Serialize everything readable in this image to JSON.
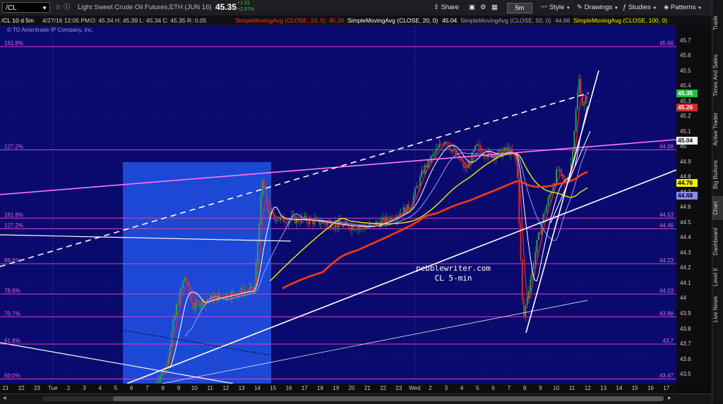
{
  "toolbar": {
    "symbol": "/CL",
    "description": "Light Sweet Crude Oil Futures,ETH (JUN 16)",
    "last_price": "45.35",
    "net_change": "+1.31",
    "pct_change": "+2.97%",
    "share_label": "Share",
    "timeframe": "5m",
    "style_label": "Style",
    "drawings_label": "Drawings",
    "studies_label": "Studies",
    "patterns_label": "Patterns"
  },
  "info": {
    "chart_title": "/CL 10 d 5m",
    "datetime": "4/27/16 12:05 PM",
    "ohlc": "O: 45.34   H: 45.39   L: 45.34   C: 45.35   R: 0.05",
    "sma10_label": "SimpleMovingAvg (CLOSE, 10, 0)",
    "sma10_value": "45.26",
    "sma20_label": "SimpleMovingAvg (CLOSE, 20, 0)",
    "sma20_value": "45.04",
    "sma50_label": "SimpleMovingAvg (CLOSE, 50, 0)",
    "sma50_value": "44.68",
    "sma100_label": "SimpleMovingAvg (CLOSE, 100, 0)",
    "copyright": "© TD Ameritrade IP Company, Inc."
  },
  "annotation": {
    "line1": "pebblewriter.com",
    "line2": "CL 5-min"
  },
  "sidebar": {
    "items": [
      "Trade",
      "Times And Sales",
      "Active Trader",
      "Big Buttons",
      "Chart",
      "Dashboard",
      "Level II",
      "Live News"
    ]
  },
  "colors": {
    "background": "#0a0a6e",
    "candle_up": "#2ea84a",
    "candle_down": "#d0342c",
    "sma10": "#ff2020",
    "sma20": "#ffffff",
    "sma50": "#9a9aff",
    "sma100": "#f0f000",
    "sma_long": "#ff3a10",
    "fib_line": "#cc44cc",
    "pink_trend": "#ff77ff",
    "highlight_box": "#1f4fe0"
  },
  "chart_data": {
    "type": "candlestick",
    "ylim": [
      43.44,
      45.8
    ],
    "yticks": [
      "45.7",
      "45.6",
      "45.5",
      "45.4",
      "45.3",
      "45.2",
      "45.1",
      "45",
      "44.9",
      "44.8",
      "44.7",
      "44.6",
      "44.5",
      "44.4",
      "44.3",
      "44.2",
      "44.1",
      "44",
      "43.9",
      "43.8",
      "43.7",
      "43.6",
      "43.5"
    ],
    "xticks": [
      "21",
      "22",
      "23",
      "Tue",
      "2",
      "3",
      "4",
      "5",
      "6",
      "7",
      "8",
      "9",
      "10",
      "11",
      "12",
      "13",
      "14",
      "15",
      "16",
      "17",
      "18",
      "19",
      "20",
      "21",
      "22",
      "23",
      "Wed",
      "2",
      "3",
      "4",
      "5",
      "6",
      "7",
      "8",
      "9",
      "10",
      "11",
      "12",
      "13",
      "14",
      "15",
      "16",
      "17"
    ],
    "fib_levels": [
      {
        "pct": "161.8%",
        "price": "45.66",
        "value": 45.66
      },
      {
        "pct": "127.2%",
        "price": "44.98",
        "value": 44.98
      },
      {
        "pct": "161.8%",
        "price": "44.53",
        "value": 44.53
      },
      {
        "pct": "127.2%",
        "price": "44.46",
        "value": 44.46
      },
      {
        "pct": "88.6%",
        "price": "44.23",
        "value": 44.23
      },
      {
        "pct": "78.6%",
        "price": "44.03",
        "value": 44.03
      },
      {
        "pct": "70.7%",
        "price": "43.88",
        "value": 43.88
      },
      {
        "pct": "61.8%",
        "price": "43.7",
        "value": 43.7
      },
      {
        "pct": "50.0%",
        "price": "43.47",
        "value": 43.47
      }
    ],
    "price_flags": [
      {
        "label": "45.35",
        "value": 45.35,
        "bg": "#1fbf3a",
        "fg": "#ffffff"
      },
      {
        "label": "45.26",
        "value": 45.26,
        "bg": "#d02a2a",
        "fg": "#ffffff"
      },
      {
        "label": "45.04",
        "value": 45.04,
        "bg": "#ffffff",
        "fg": "#000000"
      },
      {
        "label": "44.76",
        "value": 44.76,
        "bg": "#f0f000",
        "fg": "#000000"
      },
      {
        "label": "44.68",
        "value": 44.68,
        "bg": "#8a8aff",
        "fg": "#000000"
      }
    ]
  }
}
